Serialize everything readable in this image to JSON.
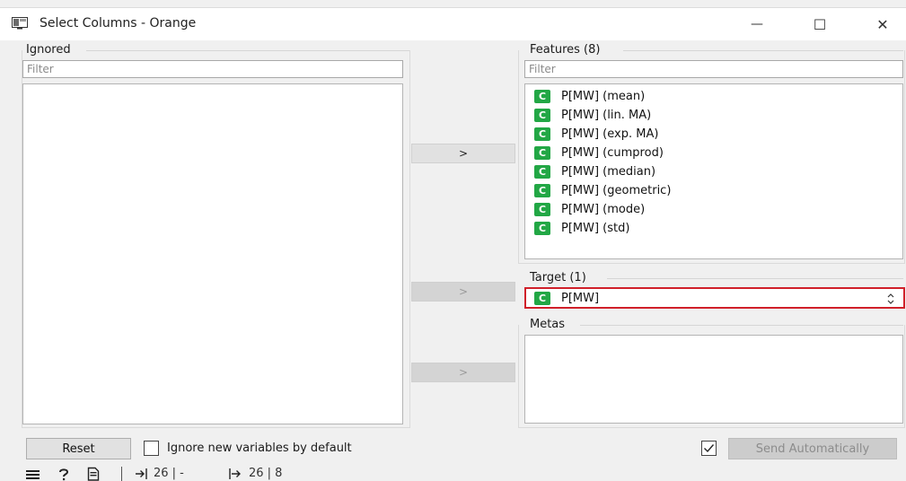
{
  "window": {
    "title": "Select Columns - Orange",
    "minimize_glyph": "—",
    "maximize_glyph": "☐",
    "close_glyph": "✕"
  },
  "ignored": {
    "label": "Ignored",
    "filter_placeholder": "Filter",
    "items": []
  },
  "features": {
    "label": "Features (8)",
    "filter_placeholder": "Filter",
    "items": [
      {
        "badge": "C",
        "label": "P[MW] (mean)"
      },
      {
        "badge": "C",
        "label": "P[MW] (lin. MA)"
      },
      {
        "badge": "C",
        "label": "P[MW] (exp. MA)"
      },
      {
        "badge": "C",
        "label": "P[MW] (cumprod)"
      },
      {
        "badge": "C",
        "label": "P[MW] (median)"
      },
      {
        "badge": "C",
        "label": "P[MW] (geometric)"
      },
      {
        "badge": "C",
        "label": "P[MW] (mode)"
      },
      {
        "badge": "C",
        "label": "P[MW] (std)"
      }
    ]
  },
  "target": {
    "label": "Target (1)",
    "badge": "C",
    "value": "P[MW]"
  },
  "metas": {
    "label": "Metas",
    "items": []
  },
  "move_buttons": {
    "features": ">",
    "target": ">",
    "metas": ">"
  },
  "bottom": {
    "reset_label": "Reset",
    "ignore_new_label": "Ignore new variables by default",
    "send_auto_label": "Send Automatically"
  },
  "statusbar": {
    "input_summary": "26 | -",
    "output_summary": "26 | 8"
  },
  "colors": {
    "continuous_badge": "#22a745",
    "highlight_border": "#d0202a"
  },
  "icons": {
    "app": "orange-app-icon",
    "menu": "hamburger-icon",
    "help": "help-icon",
    "report": "report-icon",
    "input": "input-arrow-icon",
    "output": "output-arrow-icon"
  }
}
